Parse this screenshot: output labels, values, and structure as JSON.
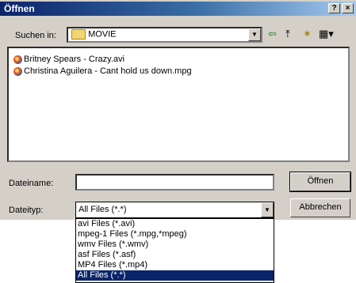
{
  "window": {
    "title": "Öffnen",
    "help": "?",
    "close": "×"
  },
  "lookin": {
    "label": "Suchen in:",
    "folder": "MOVIE"
  },
  "toolbar": {
    "back": "⇦",
    "up": "⤒",
    "newfolder": "✶",
    "view": "▦▾"
  },
  "files": [
    {
      "name": "Britney Spears - Crazy.avi"
    },
    {
      "name": "Christina Aguilera - Cant hold us down.mpg"
    }
  ],
  "filename": {
    "label": "Dateiname:",
    "value": ""
  },
  "filetype": {
    "label": "Dateityp:",
    "value": "All Files (*.*)",
    "options": [
      "avi Files (*.avi)",
      "mpeg-1 Files (*.mpg,*mpeg)",
      "wmv Files (*.wmv)",
      "asf Files (*.asf)",
      "MP4 Files (*.mp4)",
      "All Files (*.*)"
    ],
    "selected_index": 5
  },
  "buttons": {
    "open": "Öffnen",
    "cancel": "Abbrechen"
  }
}
